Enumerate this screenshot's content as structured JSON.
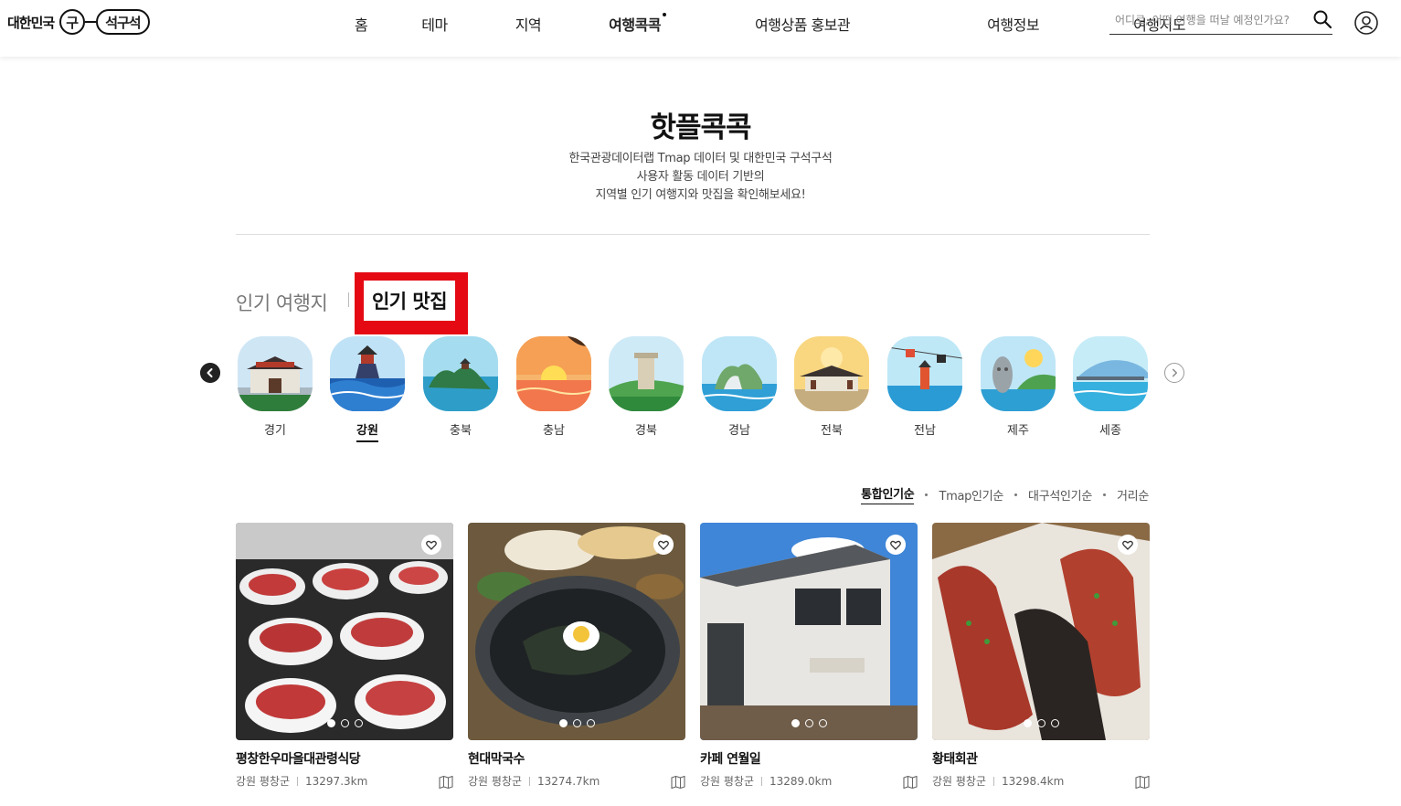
{
  "header": {
    "logo_prefix": "대한민국",
    "logo_gu": "구",
    "logo_seok": "석구석",
    "nav": [
      "홈",
      "테마",
      "지역",
      "여행콕콕",
      "여행상품 홍보관",
      "여행정보",
      "여행지도"
    ],
    "nav_active_index": 3,
    "search_placeholder": "어디로, 어떤 여행을 떠날 예정인가요?",
    "search_icon": "search-icon",
    "user_icon": "user-icon"
  },
  "hero": {
    "title": "핫플콕콕",
    "desc": [
      "한국관광데이터랩 Tmap 데이터 및 대한민국 구석구석",
      "사용자 활동 데이터 기반의",
      "지역별 인기 여행지와 맛집을 확인해보세요!"
    ]
  },
  "tabs": {
    "popular_places": "인기 여행지",
    "popular_food": "인기 맛집",
    "active": "popular_food",
    "highlight_color": "#e50914"
  },
  "regions": {
    "items": [
      "경기",
      "강원",
      "충북",
      "충남",
      "경북",
      "경남",
      "전북",
      "전남",
      "제주",
      "세종"
    ],
    "active_index": 1
  },
  "sort": {
    "options": [
      "통합인기순",
      "Tmap인기순",
      "대구석인기순",
      "거리순"
    ],
    "active_index": 0
  },
  "cards": [
    {
      "title": "평창한우마을대관령식당",
      "region": "강원 평창군",
      "distance": "13297.3km",
      "slides": 3,
      "active_slide": 0
    },
    {
      "title": "현대막국수",
      "region": "강원 평창군",
      "distance": "13274.7km",
      "slides": 3,
      "active_slide": 0
    },
    {
      "title": "카페 연월일",
      "region": "강원 평창군",
      "distance": "13289.0km",
      "slides": 3,
      "active_slide": 0
    },
    {
      "title": "황태회관",
      "region": "강원 평창군",
      "distance": "13298.4km",
      "slides": 3,
      "active_slide": 0
    }
  ]
}
